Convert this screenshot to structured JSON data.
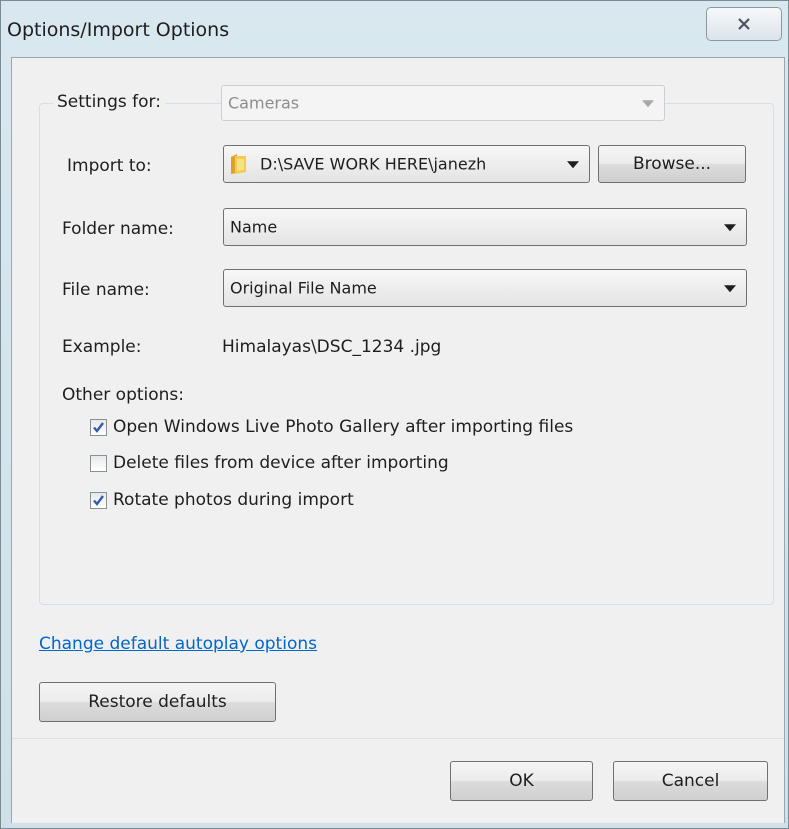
{
  "window": {
    "title": "Options/Import Options"
  },
  "settings": {
    "label": "Settings for:",
    "device_type": "Cameras"
  },
  "import_to": {
    "label": "Import to:",
    "path": "D:\\SAVE WORK HERE\\janezh",
    "browse_label": "Browse..."
  },
  "folder_name": {
    "label": "Folder name:",
    "value": "Name"
  },
  "file_name": {
    "label": "File name:",
    "value": "Original File Name"
  },
  "example": {
    "label": "Example:",
    "value": "Himalayas\\DSC_1234 .jpg"
  },
  "other_options": {
    "label": "Other options:",
    "items": [
      {
        "label": "Open Windows Live Photo Gallery after importing files",
        "checked": true
      },
      {
        "label": "Delete files from device after importing",
        "checked": false
      },
      {
        "label": "Rotate photos during import",
        "checked": true
      }
    ]
  },
  "links": {
    "autoplay": "Change default autoplay options"
  },
  "buttons": {
    "restore_defaults": "Restore defaults",
    "ok": "OK",
    "cancel": "Cancel"
  },
  "colors": {
    "link": "#0066cc",
    "check": "#2b5fa8"
  }
}
